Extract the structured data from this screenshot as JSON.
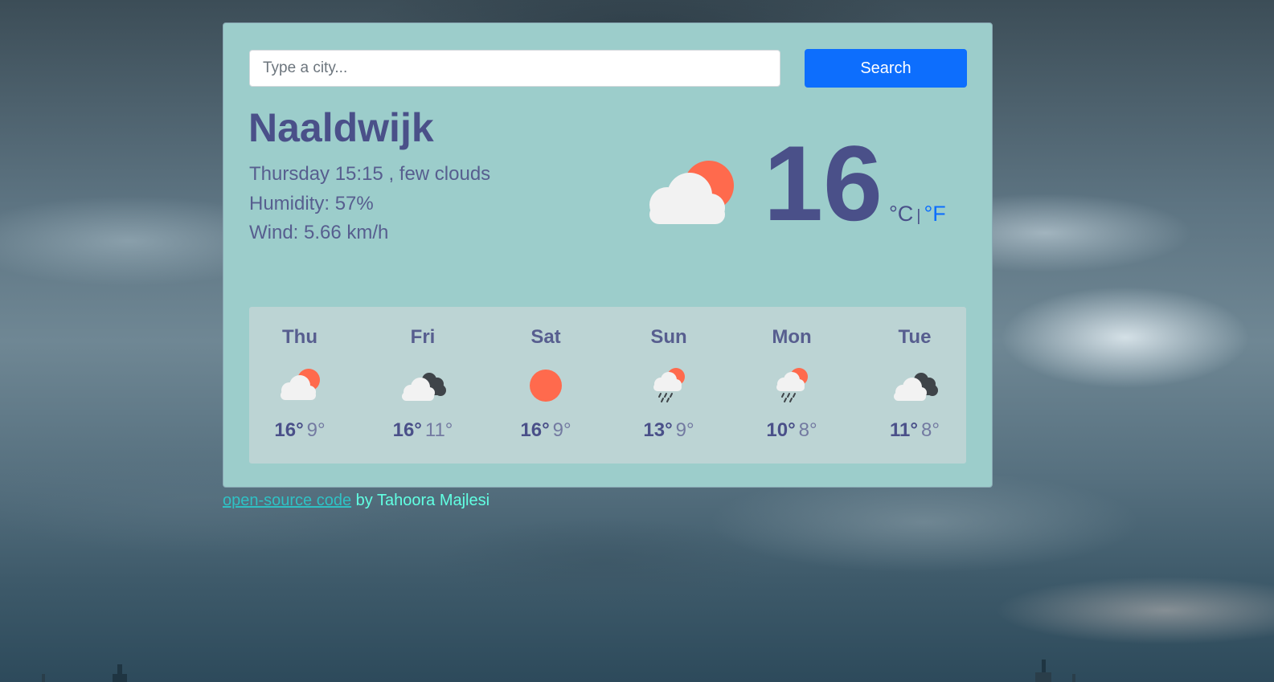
{
  "search": {
    "placeholder": "Type a city...",
    "value": "",
    "button_label": "Search"
  },
  "current": {
    "city": "Naaldwijk",
    "datetime_description": "Thursday 15:15 , few clouds",
    "humidity": "Humidity: 57%",
    "wind": "Wind: 5.66 km/h",
    "icon": "few-clouds-day-icon",
    "temperature": "16",
    "unit_celsius": "°C",
    "unit_separator": "|",
    "unit_fahrenheit": "°F"
  },
  "forecast": [
    {
      "day": "Thu",
      "max": "16°",
      "min": "9°",
      "icon": "few-clouds-day-icon"
    },
    {
      "day": "Fri",
      "max": "16°",
      "min": "11°",
      "icon": "broken-clouds-icon"
    },
    {
      "day": "Sat",
      "max": "16°",
      "min": "9°",
      "icon": "clear-sky-icon"
    },
    {
      "day": "Sun",
      "max": "13°",
      "min": "9°",
      "icon": "rain-day-icon"
    },
    {
      "day": "Mon",
      "max": "10°",
      "min": "8°",
      "icon": "rain-day-icon"
    },
    {
      "day": "Tue",
      "max": "11°",
      "min": "8°",
      "icon": "broken-clouds-icon"
    }
  ],
  "footer": {
    "link_text": "open-source code",
    "suffix": " by Tahoora Majlesi"
  },
  "colors": {
    "card": "#9ccdcb",
    "forecast_panel": "#bcd4d4",
    "primary_text": "#4a5089",
    "button": "#0d6efd",
    "sun": "#ff6a4d",
    "cloud": "#f2f2f2",
    "dark_cloud": "#3f4449"
  }
}
